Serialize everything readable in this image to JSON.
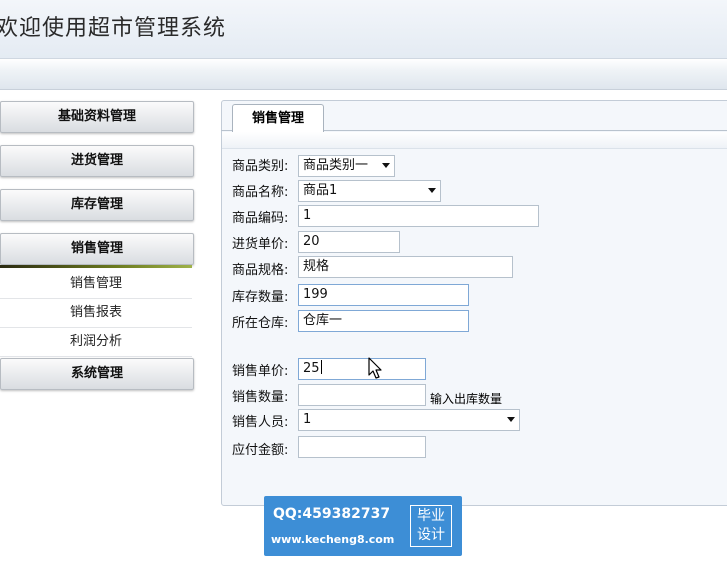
{
  "app": {
    "title": "欢迎使用超市管理系统"
  },
  "sidebar": {
    "menus": [
      {
        "label": "基础资料管理"
      },
      {
        "label": "进货管理"
      },
      {
        "label": "库存管理"
      },
      {
        "label": "销售管理"
      },
      {
        "label": "系统管理"
      }
    ],
    "submenu": [
      {
        "label": "销售管理"
      },
      {
        "label": "销售报表"
      },
      {
        "label": "利润分析"
      }
    ]
  },
  "tab": {
    "label": "销售管理"
  },
  "form": {
    "category": {
      "label": "商品类别:",
      "value": "商品类别一"
    },
    "name": {
      "label": "商品名称:",
      "value": "商品1"
    },
    "code": {
      "label": "商品编码:",
      "value": "1"
    },
    "purchase_price": {
      "label": "进货单价:",
      "value": "20"
    },
    "spec": {
      "label": "商品规格:",
      "value": "规格"
    },
    "stock_qty": {
      "label": "库存数量:",
      "value": "199"
    },
    "warehouse": {
      "label": "所在仓库:",
      "value": "仓库一"
    },
    "sale_price": {
      "label": "销售单价:",
      "value": "25"
    },
    "sale_qty": {
      "label": "销售数量:",
      "value": "",
      "hint": "输入出库数量"
    },
    "salesperson": {
      "label": "销售人员:",
      "value": "1"
    },
    "amount_due": {
      "label": "应付金额:",
      "value": ""
    }
  },
  "watermark": {
    "qq": "QQ:459382737",
    "url": "www.kecheng8.com",
    "badge_line1": "毕业",
    "badge_line2": "设计"
  },
  "colors": {
    "watermark": "#3d8ed6",
    "panel": "#f4f7fb",
    "menu_accent": "#6b7a1f"
  }
}
